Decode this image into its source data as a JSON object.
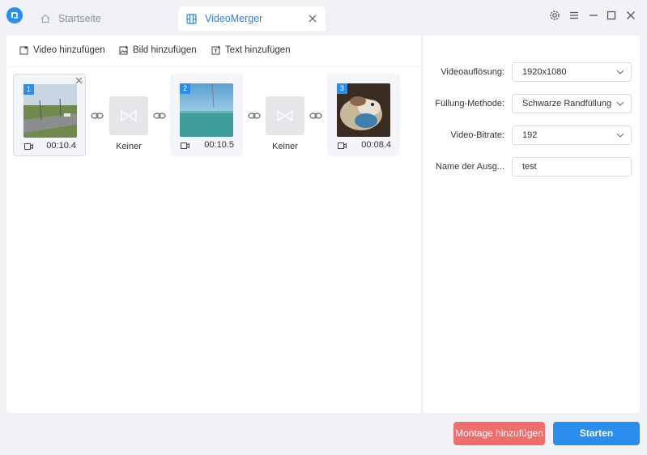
{
  "tabs": {
    "home_label": "Startseite",
    "active_label": "VideoMerger"
  },
  "toolbar": {
    "add_video": "Video hinzufügen",
    "add_image": "Bild hinzufügen",
    "add_text": "Text hinzufügen"
  },
  "clips": [
    {
      "index": "1",
      "duration": "00:10.4"
    },
    {
      "index": "2",
      "duration": "00:10.5"
    },
    {
      "index": "3",
      "duration": "00:08.4"
    }
  ],
  "transitions": [
    {
      "label": "Keiner"
    },
    {
      "label": "Keiner"
    }
  ],
  "settings": {
    "resolution_label": "Videoauflösung:",
    "resolution_value": "1920x1080",
    "fill_label": "Füllung-Methode:",
    "fill_value": "Schwarze Randfüllung",
    "bitrate_label": "Video-Bitrate:",
    "bitrate_value": "192",
    "output_label": "Name der Ausg...",
    "output_value": "test"
  },
  "buttons": {
    "montage": "Montage hinzufügen",
    "start": "Starten"
  },
  "colors": {
    "accent": "#2a8df0",
    "danger": "#f06d6d"
  }
}
